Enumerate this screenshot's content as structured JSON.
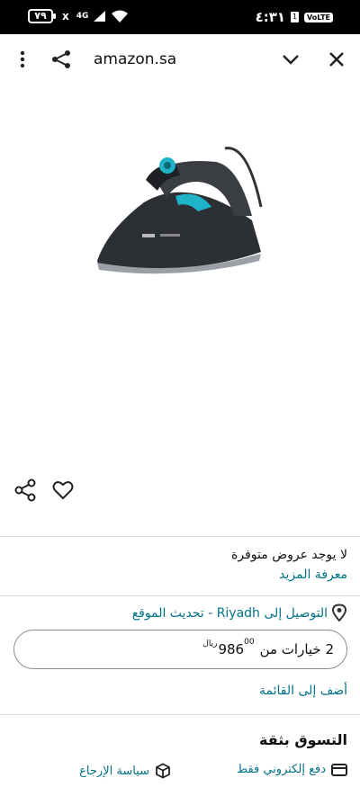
{
  "status_bar": {
    "battery": "٧٩",
    "x_mark": "x",
    "signal": "4G",
    "time": "٤:٣١",
    "sim": "1",
    "volte": "VoLTE"
  },
  "browser": {
    "url": "amazon.sa",
    "icons": [
      "more-vert-icon",
      "share-icon",
      "chevron-down-icon",
      "close-icon"
    ]
  },
  "product": {
    "image_icon": "steam-iron-image",
    "actions": [
      "share-icon",
      "heart-icon"
    ]
  },
  "offers": {
    "no_offers": "لا يوجد عروض متوفرة",
    "learn_more": "معرفة المزيد"
  },
  "delivery": {
    "text": "التوصيل إلى Riyadh - تحديث الموقع"
  },
  "options": {
    "label": "2 خيارات من",
    "price_whole": "986",
    "price_fraction": "00",
    "currency": "ريال"
  },
  "add_to_list": "أضف إلى القائمة",
  "trust": {
    "heading": "التسوق بثقة",
    "payment": "دفع إلكتروني فقط",
    "returns": "سياسة الإرجاع"
  },
  "colors": {
    "link": "#007185",
    "text": "#0f1111",
    "iron_teal": "#1fb3c9"
  }
}
